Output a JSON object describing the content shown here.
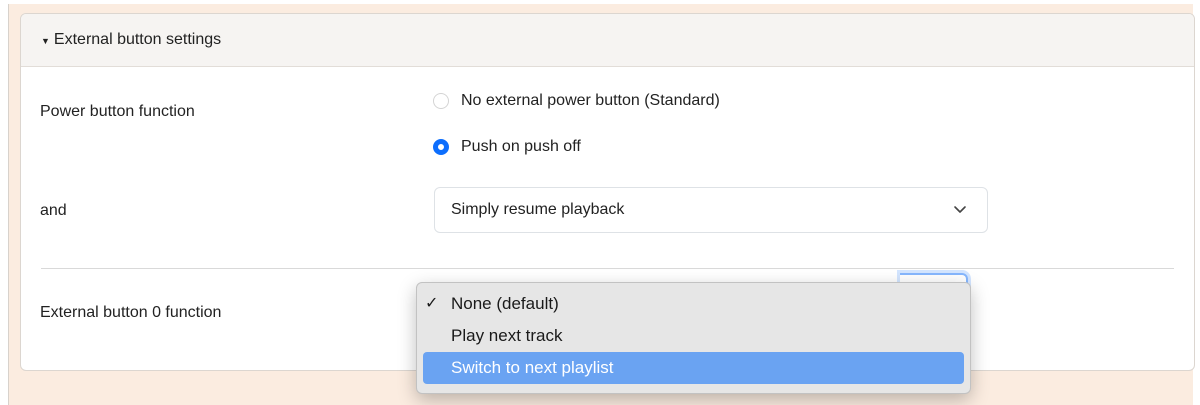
{
  "section": {
    "title": "External button settings"
  },
  "power": {
    "label": "Power button function",
    "options": [
      {
        "label": "No external power button (Standard)",
        "checked": false
      },
      {
        "label": "Push on push off",
        "checked": true
      }
    ]
  },
  "and_row": {
    "label": "and",
    "selected": "Simply resume playback"
  },
  "external0": {
    "label": "External button 0 function",
    "dropdown": {
      "options": [
        {
          "label": "None (default)",
          "selected": true
        },
        {
          "label": "Play next track",
          "selected": false
        },
        {
          "label": "Switch to next playlist",
          "highlighted": true
        }
      ],
      "check_mark": "✓"
    }
  },
  "colors": {
    "accent": "#0d6efd",
    "highlight": "#6aa3f2",
    "page_bg": "#fbece0"
  }
}
